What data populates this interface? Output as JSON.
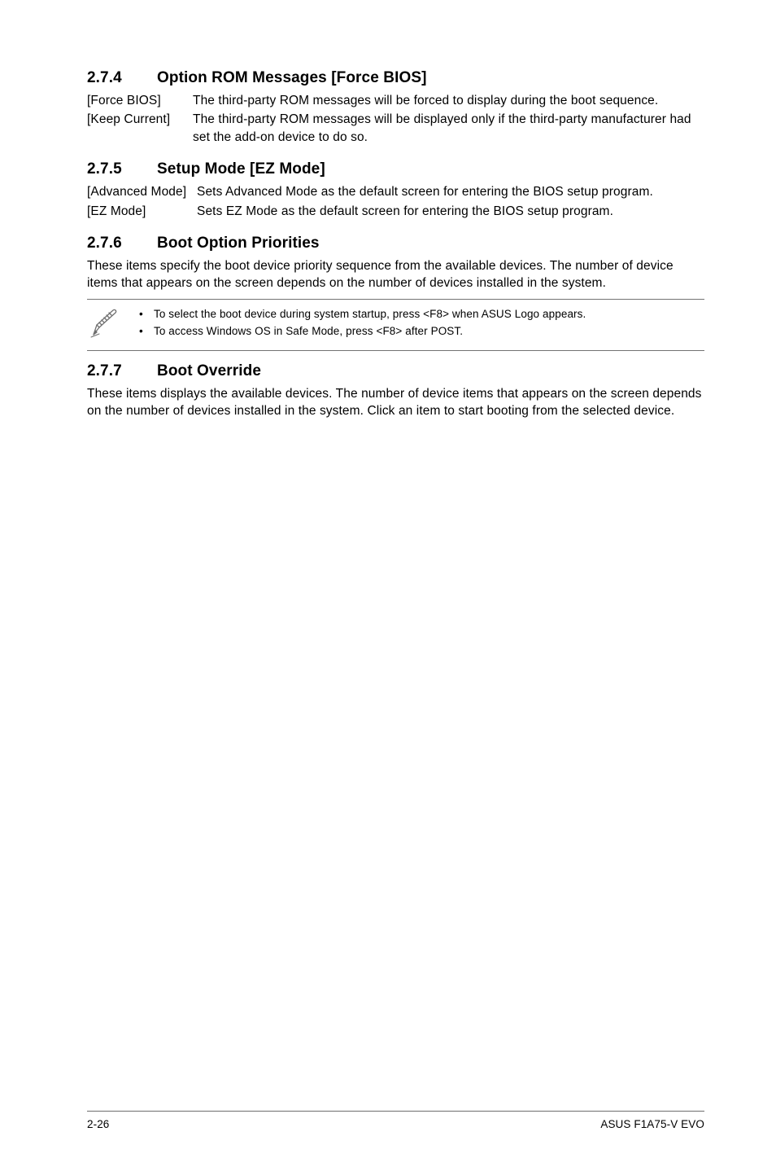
{
  "sections": {
    "s274": {
      "num": "2.7.4",
      "title": "Option ROM Messages [Force BIOS]",
      "rows": [
        {
          "term": "[Force BIOS]",
          "desc": "The third-party ROM messages will be forced to display during the boot sequence."
        },
        {
          "term": "[Keep Current]",
          "desc": "The third-party ROM messages will be displayed only if the third-party manufacturer had set the add-on device to do so."
        }
      ]
    },
    "s275": {
      "num": "2.7.5",
      "title": "Setup Mode [EZ Mode]",
      "rows": [
        {
          "term": "[Advanced Mode]",
          "desc": "Sets Advanced Mode as the default screen for entering the BIOS setup program."
        },
        {
          "term": "[EZ Mode]",
          "desc": "Sets EZ Mode as the default screen for entering the BIOS setup program."
        }
      ]
    },
    "s276": {
      "num": "2.7.6",
      "title": "Boot Option Priorities",
      "para": "These items specify the boot device priority sequence from the available devices. The number of device items that appears on the screen depends on the number of devices installed in the system.",
      "note": {
        "bul1": "To select the boot device during system startup, press <F8> when ASUS Logo appears.",
        "bul2": "To access Windows OS in Safe Mode, press <F8> after POST."
      }
    },
    "s277": {
      "num": "2.7.7",
      "title": "Boot Override",
      "para": "These items displays the available devices. The number of device items that appears on the screen depends on the number of devices installed in the system. Click an item to start booting from the selected device."
    }
  },
  "footer": {
    "left": "2-26",
    "right": "ASUS F1A75-V EVO"
  }
}
